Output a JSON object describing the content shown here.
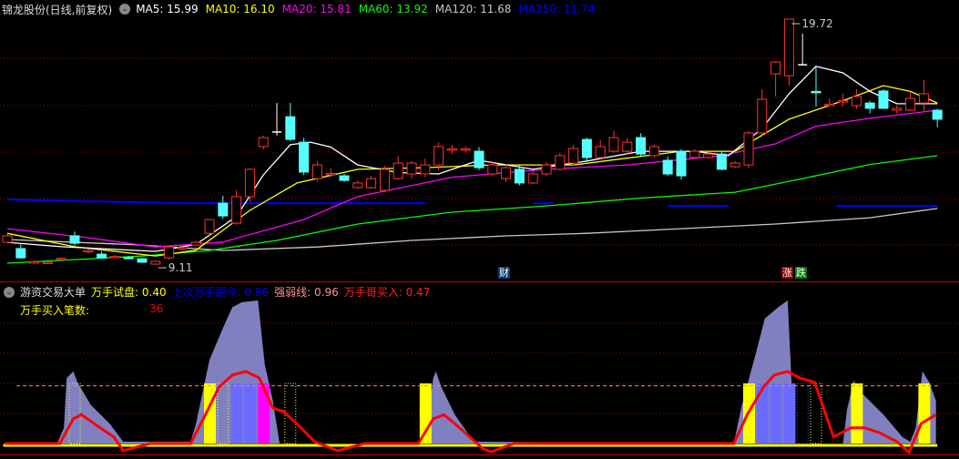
{
  "header": {
    "title": "锦龙股份(日线,前复权)",
    "ma": [
      {
        "label": "MA5: 15.99",
        "color": "#ffffff"
      },
      {
        "label": "MA10: 16.10",
        "color": "#ffff00"
      },
      {
        "label": "MA20: 15.81",
        "color": "#ff00ff"
      },
      {
        "label": "MA60: 13.92",
        "color": "#00ff00"
      },
      {
        "label": "MA120: 11.68",
        "color": "#c8c8c8"
      },
      {
        "label": "MA250: 11.74",
        "color": "#0000ff"
      }
    ]
  },
  "price_labels": {
    "high": "19.72",
    "low": "9.11"
  },
  "event_tags": {
    "cai": "财",
    "zhang": "涨",
    "die": "跌"
  },
  "indicator": {
    "name": "游资交易大单",
    "items": [
      {
        "label": "万手试盘: 0.40",
        "color": "#ffff00"
      },
      {
        "label": "上次万手距今: 0.96",
        "color": "#0000ff"
      },
      {
        "label": "强弱线: 0.96",
        "color": "#ff9090"
      },
      {
        "label": "万手哥买入: 0.47",
        "color": "#ff2020"
      }
    ],
    "count_label": "万手买入笔数:",
    "count_value": "36"
  },
  "chart_data": [
    {
      "type": "candlestick",
      "ylim": [
        9.11,
        19.72
      ],
      "candles": [
        [
          10.09,
          10.37,
          10.45,
          10.05
        ],
        [
          9.82,
          9.42,
          10.0,
          9.38
        ],
        [
          9.21,
          9.25,
          9.3,
          9.19
        ],
        [
          9.19,
          9.23,
          9.35,
          9.17
        ],
        [
          9.36,
          9.4,
          9.45,
          9.34
        ],
        [
          10.37,
          10.05,
          10.55,
          9.95
        ],
        [
          9.68,
          9.74,
          9.8,
          9.6
        ],
        [
          9.58,
          9.42,
          9.7,
          9.38
        ],
        [
          9.44,
          9.48,
          9.55,
          9.4
        ],
        [
          9.44,
          9.4,
          9.5,
          9.35
        ],
        [
          9.38,
          9.23,
          9.42,
          9.2
        ],
        [
          9.15,
          9.27,
          9.3,
          9.11
        ],
        [
          9.42,
          9.89,
          9.95,
          9.35
        ],
        [
          9.8,
          9.86,
          9.95,
          9.75
        ],
        [
          9.97,
          10.09,
          10.15,
          9.95
        ],
        [
          10.48,
          11.07,
          11.1,
          10.4
        ],
        [
          11.78,
          11.23,
          12.1,
          11.1
        ],
        [
          10.92,
          12.06,
          12.35,
          10.85
        ],
        [
          12.06,
          13.24,
          13.3,
          11.85
        ],
        [
          14.22,
          14.61,
          14.7,
          14.1
        ],
        [
          14.85,
          14.85,
          16.1,
          14.7
        ],
        [
          15.51,
          14.53,
          16.1,
          14.45
        ],
        [
          14.41,
          13.12,
          14.6,
          13.0
        ],
        [
          12.84,
          13.43,
          13.6,
          12.7
        ],
        [
          13.02,
          13.06,
          13.3,
          12.9
        ],
        [
          12.96,
          12.76,
          13.05,
          12.7
        ],
        [
          12.45,
          12.65,
          12.75,
          12.4
        ],
        [
          12.45,
          12.84,
          12.95,
          12.4
        ],
        [
          12.33,
          13.24,
          13.4,
          12.25
        ],
        [
          12.84,
          13.51,
          13.8,
          12.8
        ],
        [
          13.04,
          13.51,
          13.6,
          12.85
        ],
        [
          13.04,
          13.43,
          13.7,
          12.9
        ],
        [
          13.43,
          14.22,
          14.4,
          13.2
        ],
        [
          14.08,
          14.12,
          14.3,
          13.9
        ],
        [
          14.08,
          14.12,
          14.25,
          13.95
        ],
        [
          14.02,
          13.31,
          14.2,
          13.2
        ],
        [
          13.04,
          13.43,
          13.6,
          12.95
        ],
        [
          12.84,
          13.31,
          13.45,
          12.7
        ],
        [
          13.24,
          12.65,
          13.4,
          12.55
        ],
        [
          12.65,
          13.04,
          13.2,
          12.6
        ],
        [
          13.04,
          13.43,
          13.55,
          12.95
        ],
        [
          13.24,
          13.83,
          13.95,
          13.2
        ],
        [
          13.51,
          14.14,
          14.3,
          13.4
        ],
        [
          14.53,
          13.75,
          14.6,
          13.6
        ],
        [
          13.75,
          14.22,
          14.5,
          13.7
        ],
        [
          14.02,
          14.61,
          14.9,
          13.95
        ],
        [
          14.02,
          14.41,
          14.6,
          13.9
        ],
        [
          14.61,
          13.9,
          14.8,
          13.8
        ],
        [
          13.83,
          14.22,
          14.3,
          13.75
        ],
        [
          13.63,
          13.04,
          13.8,
          12.95
        ],
        [
          14.02,
          12.96,
          14.1,
          12.8
        ],
        [
          13.75,
          14.02,
          14.1,
          13.7
        ],
        [
          13.75,
          13.9,
          14.0,
          13.7
        ],
        [
          13.9,
          13.24,
          14.0,
          13.2
        ],
        [
          13.35,
          13.51,
          13.6,
          13.3
        ],
        [
          13.43,
          14.81,
          14.9,
          13.3
        ],
        [
          14.81,
          16.26,
          16.7,
          14.7
        ],
        [
          17.36,
          17.87,
          17.9,
          16.38
        ],
        [
          17.28,
          19.72,
          19.72,
          16.85
        ],
        [
          17.75,
          17.75,
          19.09,
          17.75
        ],
        [
          16.6,
          16.55,
          17.64,
          15.95
        ],
        [
          16.0,
          16.05,
          16.3,
          15.95
        ],
        [
          16.15,
          16.2,
          16.5,
          15.95
        ],
        [
          15.99,
          16.38,
          16.7,
          15.85
        ],
        [
          16.1,
          15.87,
          16.2,
          15.65
        ],
        [
          16.62,
          15.87,
          16.7,
          15.85
        ],
        [
          15.79,
          15.87,
          16.0,
          15.65
        ],
        [
          15.79,
          16.3,
          16.6,
          15.75
        ],
        [
          16.1,
          16.5,
          17.1,
          15.75
        ],
        [
          15.79,
          15.4,
          15.85,
          15.05
        ]
      ],
      "ma_lines": [
        {
          "name": "MA5",
          "color": "#ffffff",
          "points": [
            [
              0,
              10.09
            ],
            [
              4,
              9.9
            ],
            [
              11,
              9.7
            ],
            [
              14,
              10.0
            ],
            [
              17,
              11.2
            ],
            [
              19,
              13.0
            ],
            [
              21,
              14.3
            ],
            [
              22.5,
              14.41
            ],
            [
              24,
              14.2
            ],
            [
              26,
              13.43
            ],
            [
              29,
              13.1
            ],
            [
              32,
              13.04
            ],
            [
              35,
              13.63
            ],
            [
              39,
              13.24
            ],
            [
              43,
              13.6
            ],
            [
              47,
              14.02
            ],
            [
              51,
              14.02
            ],
            [
              53.5,
              13.83
            ],
            [
              56,
              15.0
            ],
            [
              58,
              16.5
            ],
            [
              60,
              17.68
            ],
            [
              62,
              17.4
            ],
            [
              64,
              16.6
            ],
            [
              66,
              16.07
            ],
            [
              69,
              16.07
            ]
          ]
        },
        {
          "name": "MA10",
          "color": "#ffff00",
          "points": [
            [
              0,
              10.48
            ],
            [
              5,
              9.9
            ],
            [
              11,
              9.5
            ],
            [
              14,
              9.75
            ],
            [
              18,
              11.47
            ],
            [
              21.5,
              12.65
            ],
            [
              26,
              13.24
            ],
            [
              31,
              13.31
            ],
            [
              36,
              13.43
            ],
            [
              42,
              13.43
            ],
            [
              50,
              14.02
            ],
            [
              54,
              14.02
            ],
            [
              58,
              15.4
            ],
            [
              62,
              16.2
            ],
            [
              65,
              16.85
            ],
            [
              67,
              16.6
            ],
            [
              69,
              16.1
            ]
          ]
        },
        {
          "name": "MA20",
          "color": "#ff00ff",
          "points": [
            [
              0,
              10.68
            ],
            [
              6,
              10.29
            ],
            [
              11,
              9.89
            ],
            [
              16,
              10.1
            ],
            [
              22,
              11.07
            ],
            [
              26,
              12.06
            ],
            [
              33,
              12.9
            ],
            [
              40,
              13.24
            ],
            [
              46,
              13.43
            ],
            [
              53,
              13.83
            ],
            [
              57,
              14.34
            ],
            [
              60,
              15.1
            ],
            [
              64,
              15.44
            ],
            [
              69,
              15.79
            ]
          ]
        },
        {
          "name": "MA60",
          "color": "#00ff00",
          "points": [
            [
              0,
              9.19
            ],
            [
              4,
              9.31
            ],
            [
              10,
              9.5
            ],
            [
              15,
              9.74
            ],
            [
              20,
              10.17
            ],
            [
              26,
              10.88
            ],
            [
              33,
              11.39
            ],
            [
              40,
              11.66
            ],
            [
              47,
              12.0
            ],
            [
              54,
              12.25
            ],
            [
              59,
              12.84
            ],
            [
              64,
              13.45
            ],
            [
              69,
              13.83
            ]
          ]
        },
        {
          "name": "MA120",
          "color": "#c8c8c8",
          "points": [
            [
              0,
              10.21
            ],
            [
              10,
              9.97
            ],
            [
              16,
              9.74
            ],
            [
              23,
              9.89
            ],
            [
              30,
              10.17
            ],
            [
              37,
              10.37
            ],
            [
              43,
              10.48
            ],
            [
              50,
              10.68
            ],
            [
              57,
              10.88
            ],
            [
              64,
              11.15
            ],
            [
              69,
              11.55
            ]
          ]
        }
      ],
      "ma250_segments": [
        [
          [
            0,
            11.94
          ],
          [
            6,
            11.86
          ],
          [
            13,
            11.78
          ],
          [
            31,
            11.78
          ]
        ],
        [
          [
            39,
            11.78
          ],
          [
            40.5,
            11.78
          ]
        ],
        [
          [
            49,
            11.66
          ],
          [
            53.5,
            11.66
          ]
        ],
        [
          [
            61.5,
            11.66
          ],
          [
            69,
            11.66
          ]
        ]
      ],
      "high_mark": {
        "index": 58,
        "value": 19.72
      },
      "low_mark": {
        "index": 11,
        "value": 9.11
      }
    },
    {
      "type": "indicator",
      "ylim": [
        -0.2,
        2.4
      ],
      "grid_levels": [
        0.5,
        1.0,
        1.5,
        2.0
      ],
      "reference_line": 0.96,
      "area": [
        [
          -0.5,
          0
        ],
        [
          3.7,
          0
        ],
        [
          4.2,
          0.26
        ],
        [
          4.4,
          1.09
        ],
        [
          4.9,
          1.2
        ],
        [
          5.2,
          1.02
        ],
        [
          6.2,
          0.64
        ],
        [
          7.6,
          0.33
        ],
        [
          8.6,
          0.03
        ],
        [
          13.6,
          0.03
        ],
        [
          14,
          0.33
        ],
        [
          15,
          1.39
        ],
        [
          16,
          1.92
        ],
        [
          16.7,
          2.27
        ],
        [
          17.4,
          2.35
        ],
        [
          18.6,
          2.38
        ],
        [
          19.1,
          1.32
        ],
        [
          19.7,
          0.71
        ],
        [
          20.2,
          0
        ],
        [
          30.9,
          0
        ],
        [
          31.2,
          0.41
        ],
        [
          31.6,
          1.09
        ],
        [
          31.8,
          1.2
        ],
        [
          32.2,
          0.94
        ],
        [
          33.2,
          0.48
        ],
        [
          34.6,
          0.03
        ],
        [
          53.9,
          0
        ],
        [
          54.5,
          0.64
        ],
        [
          55.5,
          1.47
        ],
        [
          56.2,
          2.08
        ],
        [
          57.2,
          2.27
        ],
        [
          57.9,
          2.38
        ],
        [
          58.4,
          0
        ],
        [
          62,
          0
        ],
        [
          62.3,
          0.56
        ],
        [
          62.8,
          1.05
        ],
        [
          63.3,
          0.86
        ],
        [
          65,
          0.48
        ],
        [
          66.4,
          0.11
        ],
        [
          67,
          0.03
        ],
        [
          67.4,
          0.26
        ],
        [
          67.7,
          0.86
        ],
        [
          67.9,
          1.2
        ],
        [
          68.4,
          1.02
        ],
        [
          68.9,
          0.71
        ],
        [
          68.9,
          0
        ]
      ],
      "red_line": [
        [
          -0.2,
          0
        ],
        [
          3.9,
          0
        ],
        [
          4.9,
          0.41
        ],
        [
          5.5,
          0.48
        ],
        [
          6.9,
          0.26
        ],
        [
          7.9,
          0.11
        ],
        [
          8.6,
          -0.12
        ],
        [
          10.6,
          0
        ],
        [
          13.6,
          0
        ],
        [
          14.7,
          0.48
        ],
        [
          15.7,
          0.94
        ],
        [
          16.7,
          1.14
        ],
        [
          17.7,
          1.2
        ],
        [
          18.7,
          1.09
        ],
        [
          19.7,
          0.59
        ],
        [
          20.5,
          0.53
        ],
        [
          21.8,
          0.26
        ],
        [
          22.8,
          0.03
        ],
        [
          24.5,
          -0.12
        ],
        [
          26.5,
          0
        ],
        [
          30.5,
          0
        ],
        [
          31.6,
          0.41
        ],
        [
          32.4,
          0.48
        ],
        [
          33.2,
          0.33
        ],
        [
          34.3,
          0.11
        ],
        [
          35.3,
          -0.09
        ],
        [
          35.9,
          -0.14
        ],
        [
          37.6,
          0
        ],
        [
          53.9,
          0
        ],
        [
          54.9,
          0.48
        ],
        [
          56.1,
          0.94
        ],
        [
          56.9,
          1.14
        ],
        [
          57.9,
          1.2
        ],
        [
          58.8,
          1.09
        ],
        [
          59.9,
          1.02
        ],
        [
          61.3,
          0.11
        ],
        [
          62.6,
          0.26
        ],
        [
          63.6,
          0.26
        ],
        [
          64.7,
          0.18
        ],
        [
          66,
          0.03
        ],
        [
          66.9,
          -0.15
        ],
        [
          67.8,
          0.33
        ],
        [
          68.9,
          0.48
        ]
      ],
      "bars": [
        [
          5,
          "dotted-yellow"
        ],
        [
          15,
          "yellow"
        ],
        [
          16,
          "dotted-yellow"
        ],
        [
          17,
          "blue"
        ],
        [
          18,
          "blue"
        ],
        [
          19,
          "magenta"
        ],
        [
          21,
          "dotted-yellow"
        ],
        [
          31,
          "yellow"
        ],
        [
          55,
          "yellow"
        ],
        [
          56,
          "blue"
        ],
        [
          57,
          "blue"
        ],
        [
          58,
          "blue"
        ],
        [
          59,
          "dotted-blue"
        ],
        [
          60,
          "dotted-yellow"
        ],
        [
          63,
          "yellow"
        ],
        [
          68,
          "yellow"
        ]
      ],
      "bar_value": 1.0
    }
  ]
}
